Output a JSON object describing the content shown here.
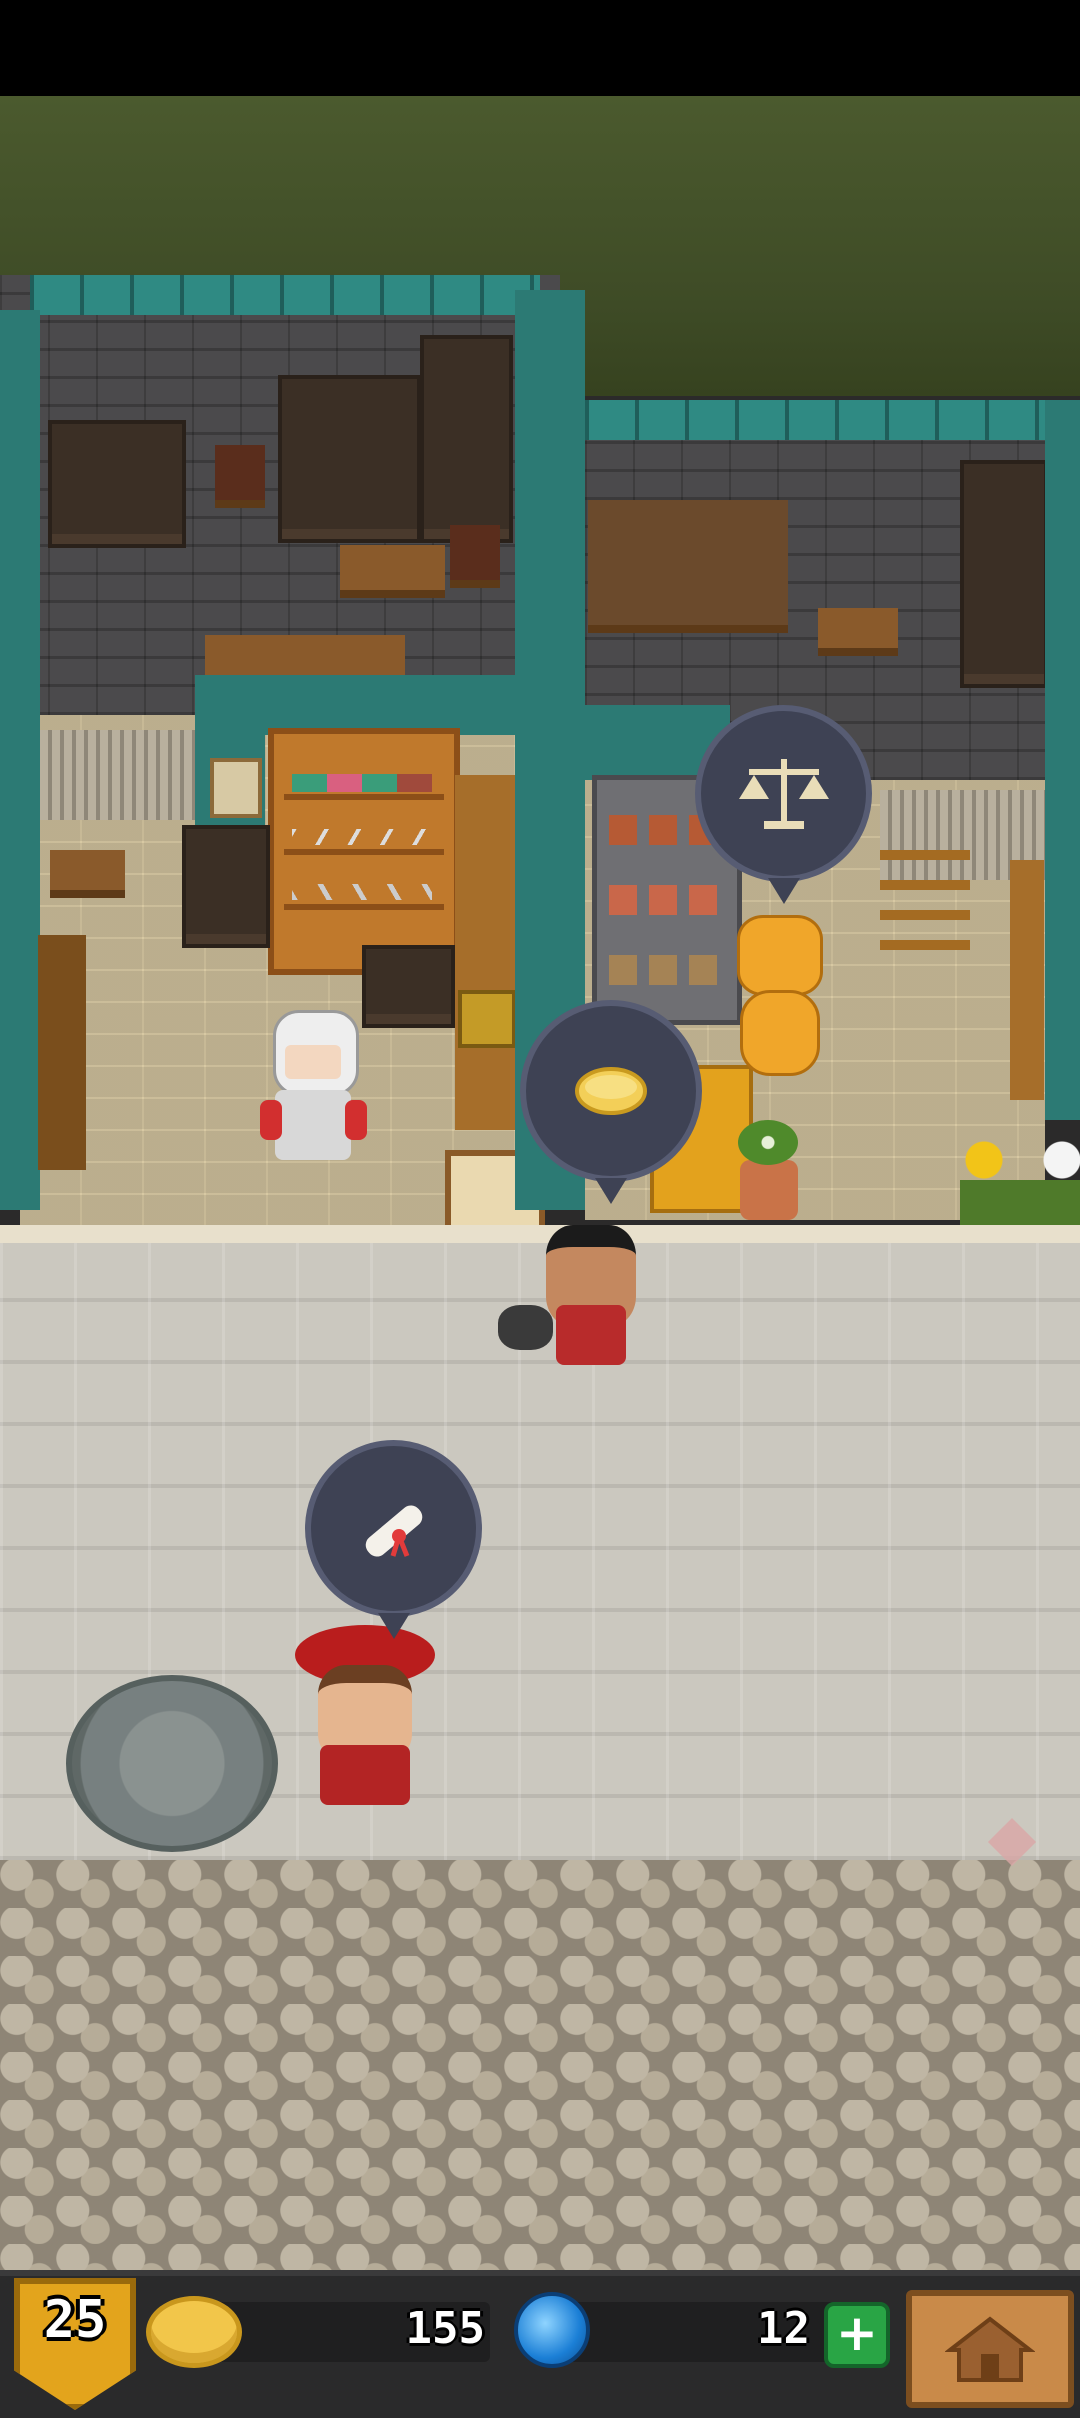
{
  "hud": {
    "level": "25",
    "coins": "155",
    "gems": "12",
    "add_gems_icon": "plus-icon",
    "home_icon": "house-icon"
  },
  "bubbles": [
    {
      "name": "scales-request",
      "icon": "scales-icon"
    },
    {
      "name": "coin-request",
      "icon": "gold-coin-icon"
    },
    {
      "name": "scroll-request",
      "icon": "scroll-icon"
    }
  ],
  "colors": {
    "grass": "#3e4b26",
    "teal_wall": "#2c7a74",
    "floor": "#d8c9a3",
    "hud_bg": "#2a2a2b",
    "coin": "#f2c64a",
    "gem": "#1b7fd6",
    "plus": "#29a545",
    "level_badge": "#e3a41c"
  }
}
